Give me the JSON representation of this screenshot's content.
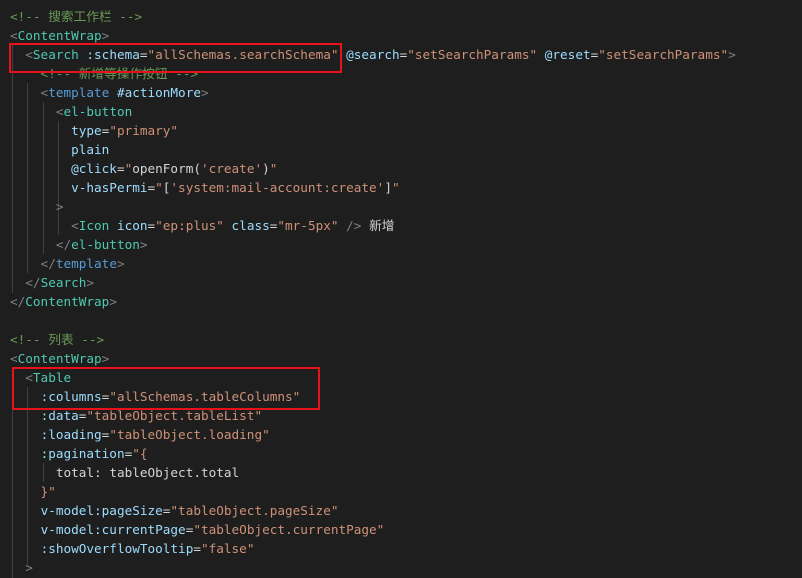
{
  "editor": {
    "lines": [
      [
        {
          "t": "<!-- ",
          "c": "cm"
        },
        {
          "t": "搜索工作栏",
          "c": "cm cjk"
        },
        {
          "t": " -->",
          "c": "cm"
        }
      ],
      [
        {
          "t": "<",
          "c": "br"
        },
        {
          "t": "ContentWrap",
          "c": "tg"
        },
        {
          "t": ">",
          "c": "br"
        }
      ],
      [
        {
          "t": "  <",
          "c": "br"
        },
        {
          "t": "Search",
          "c": "tg"
        },
        {
          "t": " ",
          "c": "tx"
        },
        {
          "t": ":schema",
          "c": "at"
        },
        {
          "t": "=",
          "c": "eq"
        },
        {
          "t": "\"allSchemas.searchSchema\"",
          "c": "st"
        },
        {
          "t": " ",
          "c": "tx"
        },
        {
          "t": "@search",
          "c": "at"
        },
        {
          "t": "=",
          "c": "eq"
        },
        {
          "t": "\"setSearchParams\"",
          "c": "st"
        },
        {
          "t": " ",
          "c": "tx"
        },
        {
          "t": "@reset",
          "c": "at"
        },
        {
          "t": "=",
          "c": "eq"
        },
        {
          "t": "\"setSearchParams\"",
          "c": "st"
        },
        {
          "t": ">",
          "c": "br"
        }
      ],
      [
        {
          "t": "    <!-- ",
          "c": "cm"
        },
        {
          "t": "新增等操作按钮",
          "c": "cm cjk"
        },
        {
          "t": " -->",
          "c": "cm"
        }
      ],
      [
        {
          "t": "    <",
          "c": "br"
        },
        {
          "t": "template",
          "c": "kw"
        },
        {
          "t": " ",
          "c": "tx"
        },
        {
          "t": "#actionMore",
          "c": "at"
        },
        {
          "t": ">",
          "c": "br"
        }
      ],
      [
        {
          "t": "      <",
          "c": "br"
        },
        {
          "t": "el-button",
          "c": "tg"
        }
      ],
      [
        {
          "t": "        ",
          "c": "tx"
        },
        {
          "t": "type",
          "c": "at"
        },
        {
          "t": "=",
          "c": "eq"
        },
        {
          "t": "\"primary\"",
          "c": "st"
        }
      ],
      [
        {
          "t": "        ",
          "c": "tx"
        },
        {
          "t": "plain",
          "c": "at"
        }
      ],
      [
        {
          "t": "        ",
          "c": "tx"
        },
        {
          "t": "@click",
          "c": "at"
        },
        {
          "t": "=",
          "c": "eq"
        },
        {
          "t": "\"",
          "c": "st"
        },
        {
          "t": "openForm",
          "c": "tx"
        },
        {
          "t": "(",
          "c": "tx"
        },
        {
          "t": "'create'",
          "c": "st"
        },
        {
          "t": ")",
          "c": "tx"
        },
        {
          "t": "\"",
          "c": "st"
        }
      ],
      [
        {
          "t": "        ",
          "c": "tx"
        },
        {
          "t": "v-hasPermi",
          "c": "at"
        },
        {
          "t": "=",
          "c": "eq"
        },
        {
          "t": "\"",
          "c": "st"
        },
        {
          "t": "[",
          "c": "tx"
        },
        {
          "t": "'system:mail-account:create'",
          "c": "st"
        },
        {
          "t": "]",
          "c": "tx"
        },
        {
          "t": "\"",
          "c": "st"
        }
      ],
      [
        {
          "t": "      >",
          "c": "br"
        }
      ],
      [
        {
          "t": "        <",
          "c": "br"
        },
        {
          "t": "Icon",
          "c": "tg"
        },
        {
          "t": " ",
          "c": "tx"
        },
        {
          "t": "icon",
          "c": "at"
        },
        {
          "t": "=",
          "c": "eq"
        },
        {
          "t": "\"ep:plus\"",
          "c": "st"
        },
        {
          "t": " ",
          "c": "tx"
        },
        {
          "t": "class",
          "c": "at"
        },
        {
          "t": "=",
          "c": "eq"
        },
        {
          "t": "\"mr-5px\"",
          "c": "st"
        },
        {
          "t": " />",
          "c": "br"
        },
        {
          "t": " ",
          "c": "tx"
        },
        {
          "t": "新增",
          "c": "tx cjk"
        }
      ],
      [
        {
          "t": "      </",
          "c": "br"
        },
        {
          "t": "el-button",
          "c": "tg"
        },
        {
          "t": ">",
          "c": "br"
        }
      ],
      [
        {
          "t": "    </",
          "c": "br"
        },
        {
          "t": "template",
          "c": "kw"
        },
        {
          "t": ">",
          "c": "br"
        }
      ],
      [
        {
          "t": "  </",
          "c": "br"
        },
        {
          "t": "Search",
          "c": "tg"
        },
        {
          "t": ">",
          "c": "br"
        }
      ],
      [
        {
          "t": "</",
          "c": "br"
        },
        {
          "t": "ContentWrap",
          "c": "tg"
        },
        {
          "t": ">",
          "c": "br"
        }
      ],
      [],
      [
        {
          "t": "<!-- ",
          "c": "cm"
        },
        {
          "t": "列表",
          "c": "cm cjk"
        },
        {
          "t": " -->",
          "c": "cm"
        }
      ],
      [
        {
          "t": "<",
          "c": "br"
        },
        {
          "t": "ContentWrap",
          "c": "tg"
        },
        {
          "t": ">",
          "c": "br"
        }
      ],
      [
        {
          "t": "  <",
          "c": "br"
        },
        {
          "t": "Table",
          "c": "tg"
        }
      ],
      [
        {
          "t": "    ",
          "c": "tx"
        },
        {
          "t": ":columns",
          "c": "at"
        },
        {
          "t": "=",
          "c": "eq"
        },
        {
          "t": "\"allSchemas.tableColumns\"",
          "c": "st"
        }
      ],
      [
        {
          "t": "    ",
          "c": "tx"
        },
        {
          "t": ":data",
          "c": "at"
        },
        {
          "t": "=",
          "c": "eq"
        },
        {
          "t": "\"tableObject.tableList\"",
          "c": "st"
        }
      ],
      [
        {
          "t": "    ",
          "c": "tx"
        },
        {
          "t": ":loading",
          "c": "at"
        },
        {
          "t": "=",
          "c": "eq"
        },
        {
          "t": "\"tableObject.loading\"",
          "c": "st"
        }
      ],
      [
        {
          "t": "    ",
          "c": "tx"
        },
        {
          "t": ":pagination",
          "c": "at"
        },
        {
          "t": "=",
          "c": "eq"
        },
        {
          "t": "\"{",
          "c": "st"
        }
      ],
      [
        {
          "t": "      ",
          "c": "tx"
        },
        {
          "t": "total: tableObject.total",
          "c": "tx"
        }
      ],
      [
        {
          "t": "    }\"",
          "c": "st"
        }
      ],
      [
        {
          "t": "    ",
          "c": "tx"
        },
        {
          "t": "v-model:pageSize",
          "c": "at"
        },
        {
          "t": "=",
          "c": "eq"
        },
        {
          "t": "\"tableObject.pageSize\"",
          "c": "st"
        }
      ],
      [
        {
          "t": "    ",
          "c": "tx"
        },
        {
          "t": "v-model:currentPage",
          "c": "at"
        },
        {
          "t": "=",
          "c": "eq"
        },
        {
          "t": "\"tableObject.currentPage\"",
          "c": "st"
        }
      ],
      [
        {
          "t": "    ",
          "c": "tx"
        },
        {
          "t": ":showOverflowTooltip",
          "c": "at"
        },
        {
          "t": "=",
          "c": "eq"
        },
        {
          "t": "\"false\"",
          "c": "st"
        }
      ],
      [
        {
          "t": "  >",
          "c": "br"
        }
      ]
    ],
    "highlights": [
      {
        "label": "search-schema-highlight"
      },
      {
        "label": "table-columns-highlight"
      }
    ]
  }
}
